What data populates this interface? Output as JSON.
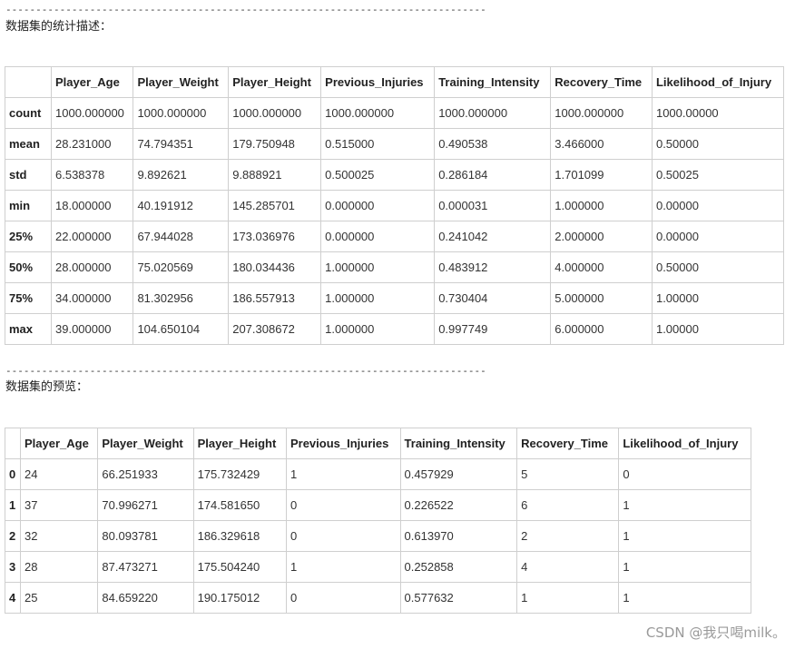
{
  "describe_section": {
    "separator": "--------------------------------------------------------------------------------",
    "caption": "数据集的统计描述：",
    "columns": [
      "",
      "Player_Age",
      "Player_Weight",
      "Player_Height",
      "Previous_Injuries",
      "Training_Intensity",
      "Recovery_Time",
      "Likelihood_of_Injury"
    ],
    "rows": [
      {
        "label": "count",
        "cells": [
          "1000.000000",
          "1000.000000",
          "1000.000000",
          "1000.000000",
          "1000.000000",
          "1000.000000",
          "1000.00000"
        ]
      },
      {
        "label": "mean",
        "cells": [
          "28.231000",
          "74.794351",
          "179.750948",
          "0.515000",
          "0.490538",
          "3.466000",
          "0.50000"
        ]
      },
      {
        "label": "std",
        "cells": [
          "6.538378",
          "9.892621",
          "9.888921",
          "0.500025",
          "0.286184",
          "1.701099",
          "0.50025"
        ]
      },
      {
        "label": "min",
        "cells": [
          "18.000000",
          "40.191912",
          "145.285701",
          "0.000000",
          "0.000031",
          "1.000000",
          "0.00000"
        ]
      },
      {
        "label": "25%",
        "cells": [
          "22.000000",
          "67.944028",
          "173.036976",
          "0.000000",
          "0.241042",
          "2.000000",
          "0.00000"
        ]
      },
      {
        "label": "50%",
        "cells": [
          "28.000000",
          "75.020569",
          "180.034436",
          "1.000000",
          "0.483912",
          "4.000000",
          "0.50000"
        ]
      },
      {
        "label": "75%",
        "cells": [
          "34.000000",
          "81.302956",
          "186.557913",
          "1.000000",
          "0.730404",
          "5.000000",
          "1.00000"
        ]
      },
      {
        "label": "max",
        "cells": [
          "39.000000",
          "104.650104",
          "207.308672",
          "1.000000",
          "0.997749",
          "6.000000",
          "1.00000"
        ]
      }
    ]
  },
  "preview_section": {
    "separator": "--------------------------------------------------------------------------------",
    "caption": "数据集的预览：",
    "columns": [
      "",
      "Player_Age",
      "Player_Weight",
      "Player_Height",
      "Previous_Injuries",
      "Training_Intensity",
      "Recovery_Time",
      "Likelihood_of_Injury"
    ],
    "rows": [
      {
        "label": "0",
        "cells": [
          "24",
          "66.251933",
          "175.732429",
          "1",
          "0.457929",
          "5",
          "0"
        ]
      },
      {
        "label": "1",
        "cells": [
          "37",
          "70.996271",
          "174.581650",
          "0",
          "0.226522",
          "6",
          "1"
        ]
      },
      {
        "label": "2",
        "cells": [
          "32",
          "80.093781",
          "186.329618",
          "0",
          "0.613970",
          "2",
          "1"
        ]
      },
      {
        "label": "3",
        "cells": [
          "28",
          "87.473271",
          "175.504240",
          "1",
          "0.252858",
          "4",
          "1"
        ]
      },
      {
        "label": "4",
        "cells": [
          "25",
          "84.659220",
          "190.175012",
          "0",
          "0.577632",
          "1",
          "1"
        ]
      }
    ]
  },
  "watermark": "CSDN @我只喝milk。"
}
